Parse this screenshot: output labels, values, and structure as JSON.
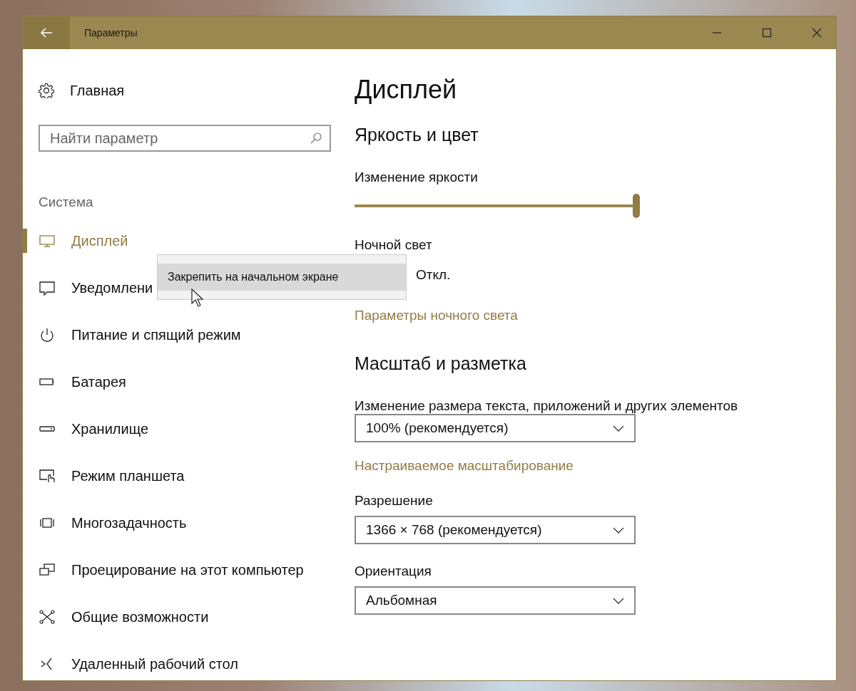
{
  "window": {
    "title": "Параметры"
  },
  "sidebar": {
    "home": "Главная",
    "search": {
      "placeholder": "Найти параметр"
    },
    "section": "Система",
    "items": [
      {
        "label": "Дисплей",
        "kind": "monitor",
        "selected": true
      },
      {
        "label": "Уведомлени",
        "kind": "message",
        "selected": false
      },
      {
        "label": "Питание и спящий режим",
        "kind": "power",
        "selected": false
      },
      {
        "label": "Батарея",
        "kind": "battery",
        "selected": false
      },
      {
        "label": "Хранилище",
        "kind": "storage",
        "selected": false
      },
      {
        "label": "Режим планшета",
        "kind": "tablet",
        "selected": false
      },
      {
        "label": "Многозадачность",
        "kind": "multitask",
        "selected": false
      },
      {
        "label": "Проецирование на этот компьютер",
        "kind": "project",
        "selected": false
      },
      {
        "label": "Общие возможности",
        "kind": "share",
        "selected": false
      },
      {
        "label": "Удаленный рабочий стол",
        "kind": "remote",
        "selected": false
      }
    ]
  },
  "content": {
    "title": "Дисплей",
    "items": [
      {
        "kind": "heading",
        "text": "Яркость и цвет"
      },
      {
        "kind": "label",
        "text": "Изменение яркости"
      },
      {
        "kind": "slider",
        "level": 1
      },
      {
        "kind": "label",
        "text": "Ночной свет"
      },
      {
        "kind": "toggle",
        "text": "Откл."
      },
      {
        "kind": "link",
        "text": "Параметры ночного света"
      },
      {
        "kind": "heading",
        "text": "Масштаб и разметка"
      },
      {
        "kind": "label",
        "text": "Изменение размера текста, приложений и других элементов"
      },
      {
        "kind": "dropdown",
        "text": "100% (рекомендуется)"
      },
      {
        "kind": "link",
        "text": "Настраиваемое масштабирование"
      },
      {
        "kind": "label",
        "text": "Разрешение"
      },
      {
        "kind": "dropdown",
        "text": "1366 × 768 (рекомендуется)"
      },
      {
        "kind": "label",
        "text": "Ориентация"
      },
      {
        "kind": "dropdown",
        "text": "Альбомная"
      }
    ]
  },
  "context_menu": {
    "items": [
      {
        "label": "Закрепить на начальном экране",
        "selected": true
      }
    ]
  }
}
